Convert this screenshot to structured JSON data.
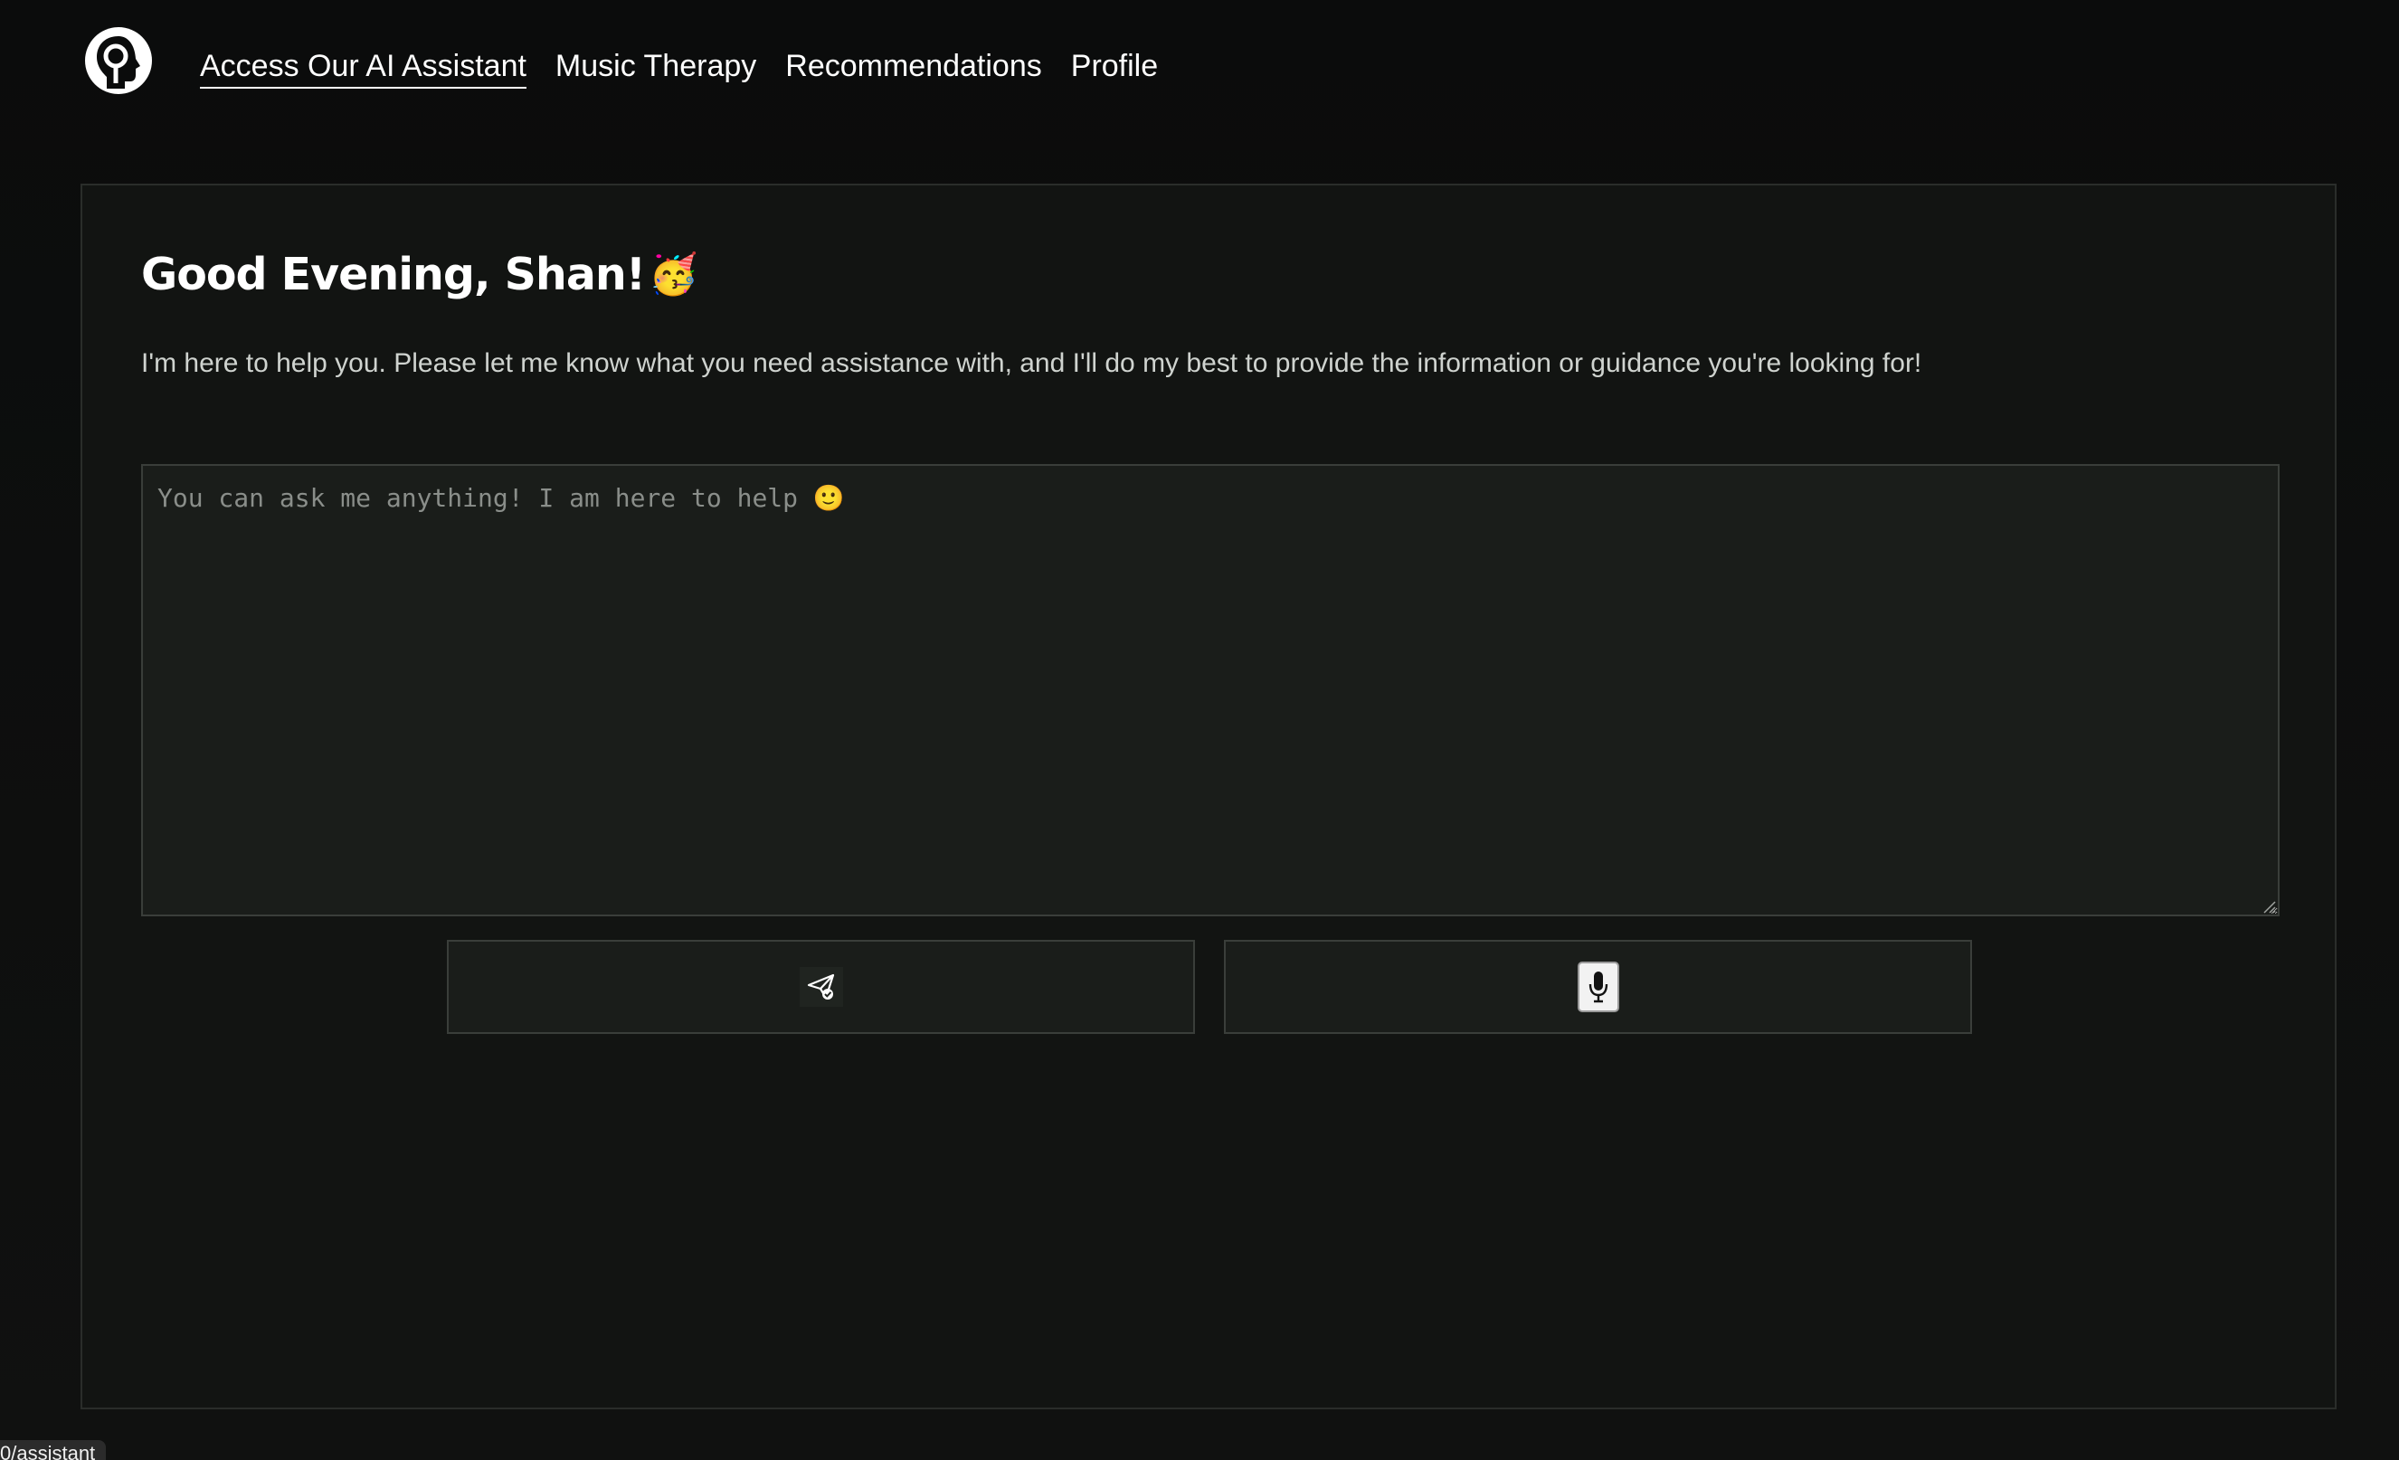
{
  "nav": {
    "logo_icon": "head-brain-logo-icon",
    "links": [
      {
        "label": "Access Our AI Assistant",
        "active": true
      },
      {
        "label": "Music Therapy",
        "active": false
      },
      {
        "label": "Recommendations",
        "active": false
      },
      {
        "label": "Profile",
        "active": false
      }
    ]
  },
  "assistant": {
    "greeting": "Good Evening, Shan!",
    "greeting_emoji": "🥳",
    "intro": "I'm here to help you. Please let me know what you need assistance with, and I'll do my best to provide the information or guidance you're looking for!",
    "prompt_placeholder": "You can ask me anything! I am here to help 🙂",
    "prompt_value": "",
    "send_icon": "send-paper-plane-icon",
    "mic_icon": "microphone-icon"
  },
  "status_bar": {
    "url": "0/assistant"
  },
  "colors": {
    "background": "#0b0c0c",
    "panel": "#121412",
    "input": "#1a1d1a",
    "text": "#ffffff",
    "muted_text": "#cfd3cf"
  }
}
